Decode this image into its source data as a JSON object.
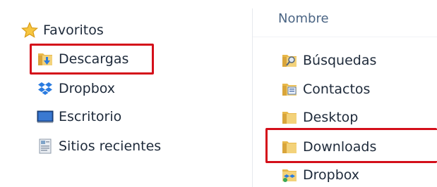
{
  "nav": {
    "favorites_label": "Favoritos",
    "items": [
      {
        "label": "Descargas",
        "icon": "downloads-folder-icon"
      },
      {
        "label": "Dropbox",
        "icon": "dropbox-icon"
      },
      {
        "label": "Escritorio",
        "icon": "desktop-icon"
      },
      {
        "label": "Sitios recientes",
        "icon": "recent-places-icon"
      }
    ]
  },
  "content": {
    "column_header": "Nombre",
    "items": [
      {
        "label": "Búsquedas",
        "icon": "searches-folder-icon"
      },
      {
        "label": "Contactos",
        "icon": "contacts-folder-icon"
      },
      {
        "label": "Desktop",
        "icon": "folder-icon"
      },
      {
        "label": "Downloads",
        "icon": "folder-icon"
      },
      {
        "label": "Dropbox",
        "icon": "dropbox-folder-icon"
      }
    ]
  },
  "colors": {
    "highlight": "#d40f1a",
    "folder": "#e8b84a",
    "text": "#1e2a3a",
    "header_text": "#4b6584"
  }
}
